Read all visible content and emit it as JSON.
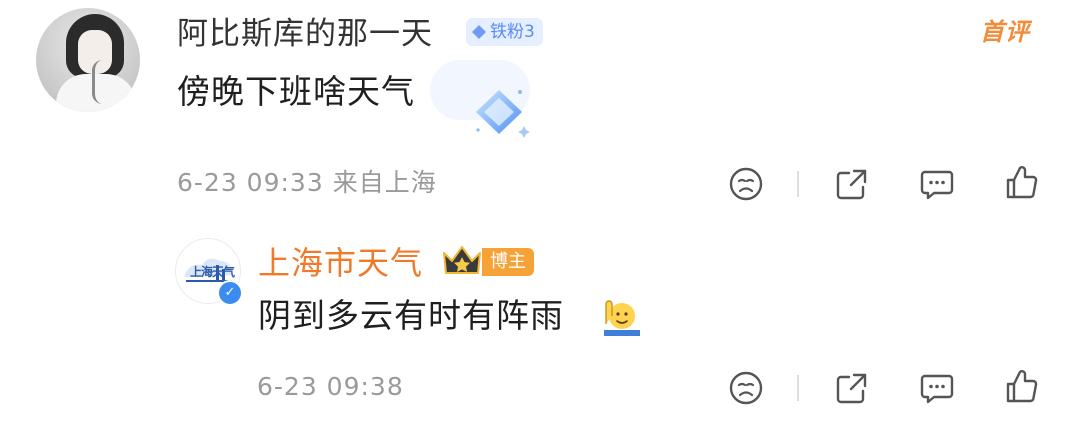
{
  "comment": {
    "username": "阿比斯库的那一天",
    "fan_badge": "铁粉3",
    "first_tag": "首评",
    "text": "傍晚下班啥天气",
    "date": "6-23 09:33",
    "location": "来自上海",
    "sticker": "diamond-sticker"
  },
  "reply": {
    "username": "上海市天气",
    "owner_badge": "博主",
    "avatar_text": "上海天气",
    "text": "阴到多云有时有阵雨",
    "emoji": "raised-hand-emoji",
    "date": "6-23 09:38"
  },
  "colors": {
    "primary_text": "#1f1f1f",
    "meta_text": "#9a9a9a",
    "blogger_name": "#f07a2a",
    "first_tag": "#f08c3c",
    "fan_badge_bg": "#e6efff",
    "fan_badge_text": "#5a8bf5",
    "owner_badge_bg": "#f5a336"
  }
}
